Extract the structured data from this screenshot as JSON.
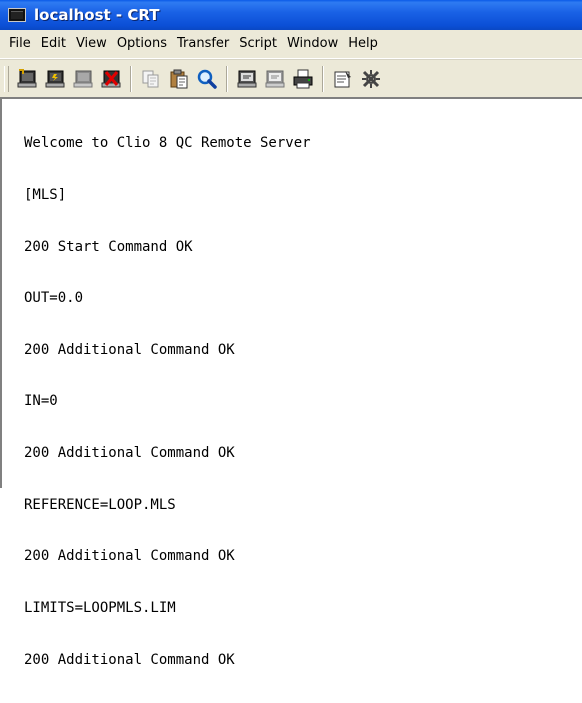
{
  "window": {
    "title": "localhost - CRT",
    "icon": "terminal-icon"
  },
  "menu": {
    "items": [
      "File",
      "Edit",
      "View",
      "Options",
      "Transfer",
      "Script",
      "Window",
      "Help"
    ]
  },
  "toolbar": {
    "buttons": [
      "connect-icon",
      "quick-connect-icon",
      "connect-tab-icon",
      "disconnect-icon",
      "copy-icon",
      "paste-icon",
      "find-icon",
      "session-options-icon",
      "global-options-icon",
      "print-icon",
      "properties-icon",
      "map-keys-icon"
    ]
  },
  "terminal": {
    "lines": [
      "Welcome to Clio 8 QC Remote Server",
      "[MLS]",
      "200 Start Command OK",
      "OUT=0.0",
      "200 Additional Command OK",
      "IN=0",
      "200 Additional Command OK",
      "REFERENCE=LOOP.MLS",
      "200 Additional Command OK",
      "LIMITS=LOOPMLS.LIM",
      "200 Additional Command OK"
    ]
  },
  "colors": {
    "titlebar": "#0b4fd6",
    "chrome": "#ece9d8",
    "terminal_bg": "#ffffff",
    "terminal_text": "#000000"
  }
}
